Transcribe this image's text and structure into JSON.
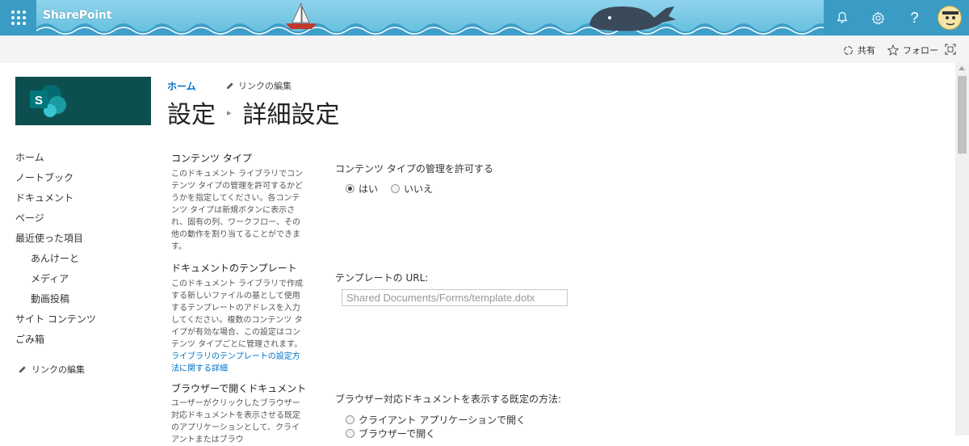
{
  "suitebar": {
    "brand": "SharePoint",
    "icons": [
      "waffle-icon",
      "bell-icon",
      "gear-icon",
      "help-icon",
      "avatar"
    ],
    "help_glyph": "?"
  },
  "commandbar": {
    "share_label": "共有",
    "follow_label": "フォロー"
  },
  "breadcrumb": {
    "home": "ホーム",
    "edit_links": "リンクの編集"
  },
  "title": {
    "parent": "設定",
    "current": "詳細設定"
  },
  "leftnav": {
    "items": [
      {
        "label": "ホーム"
      },
      {
        "label": "ノートブック"
      },
      {
        "label": "ドキュメント"
      },
      {
        "label": "ページ"
      },
      {
        "label": "最近使った項目"
      },
      {
        "label": "あんけーと"
      },
      {
        "label": "メディア"
      },
      {
        "label": "動画投稿"
      },
      {
        "label": "サイト コンテンツ"
      },
      {
        "label": "ごみ箱"
      }
    ],
    "edit_links": "リンクの編集"
  },
  "sections": {
    "content_types": {
      "title": "コンテンツ タイプ",
      "description": "このドキュメント ライブラリでコンテンツ タイプの管理を許可するかどうかを指定してください。各コンテンツ タイプは新規ボタンに表示され、固有の列、ワークフロー、その他の動作を割り当てることができます。",
      "field_label": "コンテンツ タイプの管理を許可する",
      "options": [
        "はい",
        "いいえ"
      ],
      "selected": "はい"
    },
    "template": {
      "title": "ドキュメントのテンプレート",
      "description": "このドキュメント ライブラリで作成する新しいファイルの基として使用するテンプレートのアドレスを入力してください。複数のコンテンツ タイプが有効な場合、この設定はコンテンツ タイプごとに管理されます。",
      "link": "ライブラリのテンプレートの設定方法に関する詳細",
      "field_label": "テンプレートの URL:",
      "url_value": "Shared Documents/Forms/template.dotx"
    },
    "browser": {
      "title": "ブラウザーで開くドキュメント",
      "description": "ユーザーがクリックしたブラウザー対応ドキュメントを表示させる既定のアプリケーションとして、クライアントまたはブラウ",
      "field_label": "ブラウザー対応ドキュメントを表示する既定の方法:",
      "options": [
        "クライアント アプリケーションで開く",
        "ブラウザーで開く"
      ]
    }
  }
}
